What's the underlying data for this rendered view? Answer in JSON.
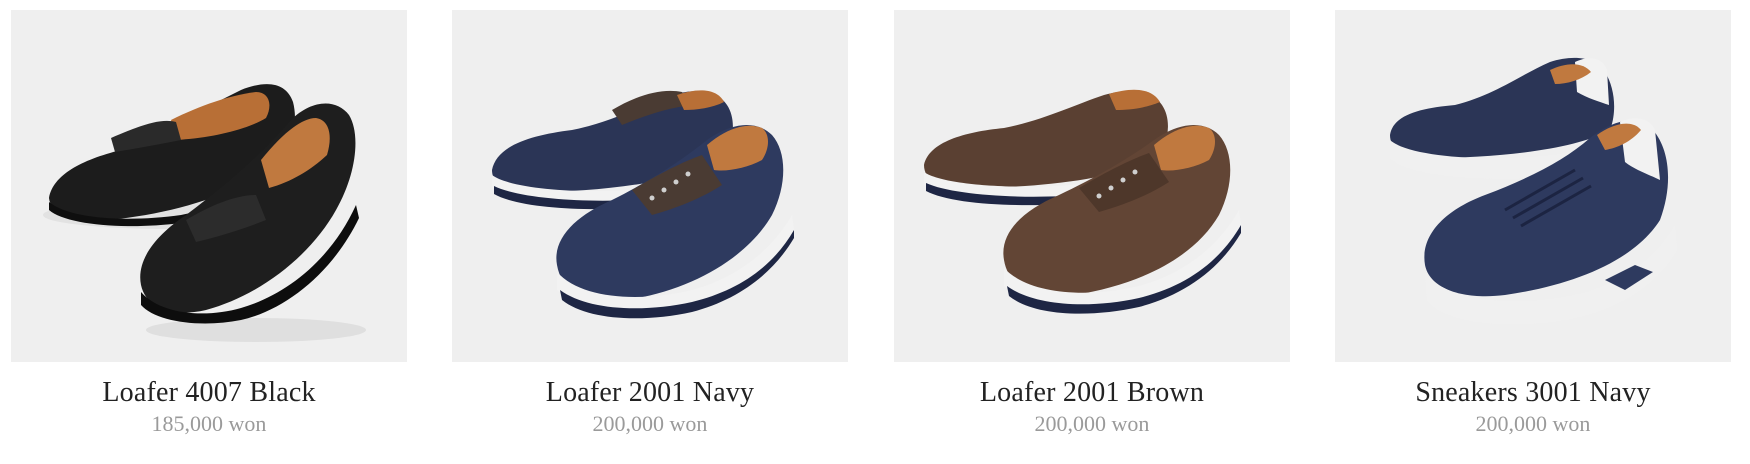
{
  "products": [
    {
      "name": "Loafer 4007 Black",
      "price": "185,000 won",
      "image_icon": "black-loafer-shoes-icon"
    },
    {
      "name": "Loafer 2001 Navy",
      "price": "200,000 won",
      "image_icon": "navy-lace-up-shoes-icon"
    },
    {
      "name": "Loafer 2001 Brown",
      "price": "200,000 won",
      "image_icon": "brown-lace-up-shoes-icon"
    },
    {
      "name": "Sneakers 3001 Navy",
      "price": "200,000 won",
      "image_icon": "navy-sneakers-icon"
    }
  ],
  "colors": {
    "image_background": "#efefef",
    "name_text": "#222222",
    "price_text": "#9a9a9a",
    "black_leather": "#1c1c1c",
    "navy_leather": "#2b3556",
    "brown_leather": "#5a4032",
    "lining_tan": "#c0793f",
    "sole_white": "#f2f2f2"
  }
}
